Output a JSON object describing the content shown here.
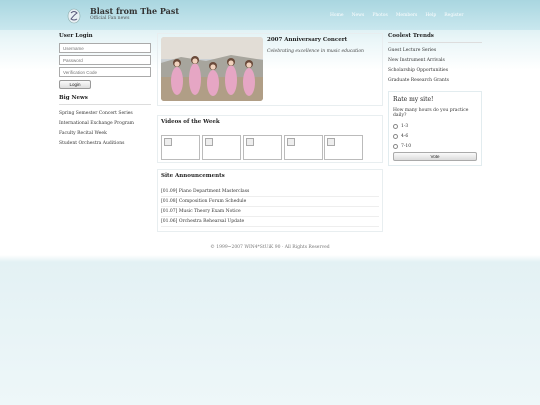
{
  "site": {
    "title": "Blast from The Past",
    "subtitle": "Official Fan news"
  },
  "topnav": [
    "Home",
    "News",
    "Photos",
    "Members",
    "Help",
    "Register"
  ],
  "login": {
    "title": "User Login",
    "username_placeholder": "Username",
    "password_placeholder": "Password",
    "verification_placeholder": "Verification Code",
    "button_label": "Login"
  },
  "big_news": {
    "title": "Big News",
    "items": [
      "Spring Semester Concert Series",
      "International Exchange Program",
      "Faculty Recital Week",
      "Student Orchestra Auditions"
    ]
  },
  "feature": {
    "title": "2007 Anniversary Concert",
    "subtitle": "Celebrating excellence in music education"
  },
  "videos": {
    "title": "Videos of the Week",
    "count": 5
  },
  "announcements": {
    "title": "Site Announcements",
    "items": [
      "[01.09] Piano Department Masterclass",
      "[01.08] Composition Forum Schedule",
      "[01.07] Music Theory Exam Notice",
      "[01.06] Orchestra Rehearsal Update"
    ]
  },
  "trends": {
    "title": "Coolest Trends",
    "items": [
      "Guest Lecture Series",
      "New Instrument Arrivals",
      "Scholarship Opportunities",
      "Graduate Research Grants"
    ]
  },
  "poll": {
    "title": "Rate my site!",
    "question": "How many hours do you practice daily?",
    "options": [
      "1-3",
      "4-6",
      "7-10"
    ],
    "vote_label": "Vote"
  },
  "footer": "© 1999~2007 WIN4*StUiK 90 · All Rights Reserved",
  "colors": {
    "header_bg": "#a9d6e0",
    "page_bg": "#ffffff"
  }
}
